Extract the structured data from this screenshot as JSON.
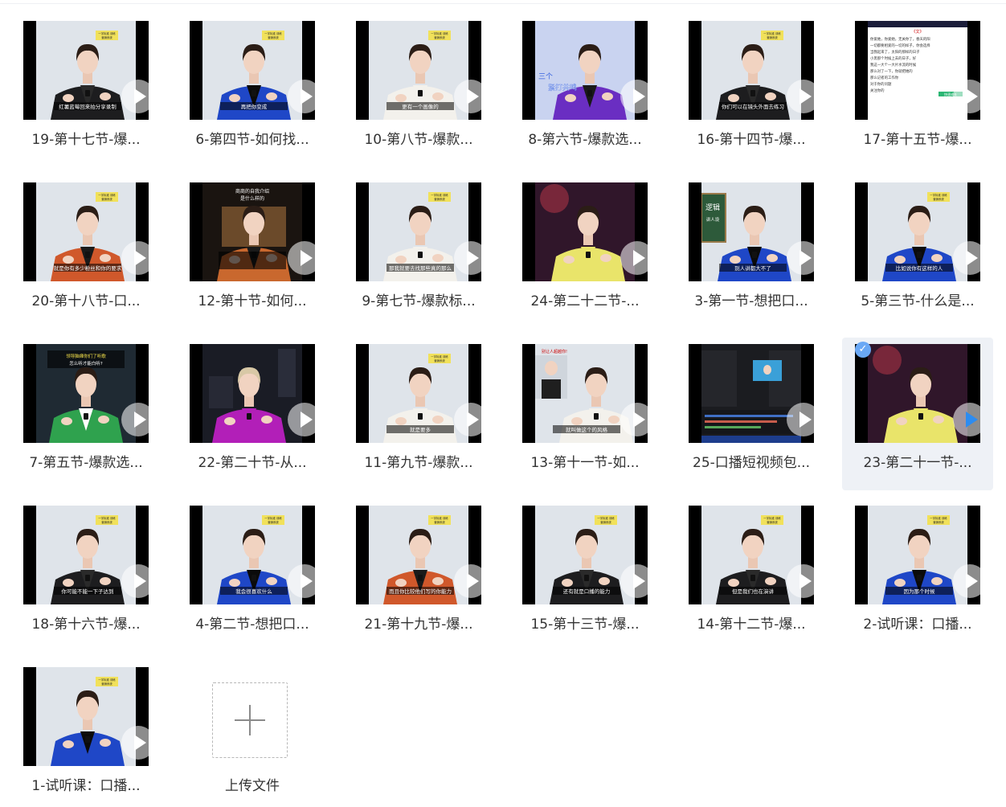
{
  "files": [
    {
      "name": "19-第十七节-爆...",
      "theme": "black",
      "caption": "红薯蓝莓回来拍分享录制"
    },
    {
      "name": "6-第四节-如何找...",
      "theme": "blue",
      "caption": "再把你变成"
    },
    {
      "name": "10-第八节-爆款...",
      "theme": "white",
      "caption": "更有一个画像的"
    },
    {
      "name": "8-第六节-爆款选...",
      "theme": "purple",
      "caption": "",
      "overlay": "三个\n紧打共鸣"
    },
    {
      "name": "16-第十四节-爆...",
      "theme": "black",
      "caption": "你们可以在镜头外面去练习"
    },
    {
      "name": "17-第十五节-爆...",
      "theme": "doc",
      "caption": "",
      "doc_title": "《文》",
      "doc_text": [
        "你爱她，你爱她，无关你了，春天的阳",
        "一切都要相爱的一切的样子，你会选择",
        "当我起来了，太阳的那样的日子",
        "小黑那个时候上去的日子，好",
        "我这一大个一大片水流的时候",
        "那么对了一下，你就把她的",
        "那么记者的工作你",
        "对于你的问题",
        "关注你的"
      ],
      "doc_tag": "快速成长"
    },
    {
      "name": "20-第十八节-口...",
      "theme": "orange",
      "caption": "就是你有多少粉丝和你的要求"
    },
    {
      "name": "12-第十节-如何...",
      "theme": "book",
      "caption": "",
      "board_title": "商商的自我介绍\n是什么样的"
    },
    {
      "name": "9-第七节-爆款标...",
      "theme": "white",
      "caption": "那我就要去找那些真的那么"
    },
    {
      "name": "24-第二十二节-...",
      "theme": "yellowdress",
      "caption": ""
    },
    {
      "name": "3-第一节-想把口...",
      "theme": "board",
      "caption": "别人讲都大不了",
      "board_text": "逻辑\n讲人设"
    },
    {
      "name": "5-第三节-什么是...",
      "theme": "blue",
      "caption": "比如说你有这样的人"
    },
    {
      "name": "7-第五节-爆款选...",
      "theme": "green",
      "caption": "",
      "overlay": "领导脑瘫你们了听歌\n怎么听才能白听?"
    },
    {
      "name": "22-第二十节-从...",
      "theme": "magenta",
      "caption": ""
    },
    {
      "name": "11-第九节-爆款...",
      "theme": "white",
      "caption": "就是要多"
    },
    {
      "name": "13-第十一节-如...",
      "theme": "pip",
      "caption": "就叫做这个的风格",
      "overlay": "别让人超越你!"
    },
    {
      "name": "25-口播短视频包...",
      "theme": "editor",
      "caption": ""
    },
    {
      "name": "23-第二十一节-...",
      "theme": "yellowdress",
      "caption": "",
      "selected": true
    },
    {
      "name": "18-第十六节-爆...",
      "theme": "black",
      "caption": "你可能不能一下子达到"
    },
    {
      "name": "4-第二节-想把口...",
      "theme": "blue",
      "caption": "我会很喜欢什么"
    },
    {
      "name": "21-第十九节-爆...",
      "theme": "orange",
      "caption": "而且你比较他们写的你能力"
    },
    {
      "name": "15-第十三节-爆...",
      "theme": "black",
      "caption": "还有就是口播的能力"
    },
    {
      "name": "14-第十二节-爆...",
      "theme": "black",
      "caption": "但是我们也在演讲"
    },
    {
      "name": "2-试听课：口播...",
      "theme": "blue",
      "caption": "因为那个时候"
    },
    {
      "name": "1-试听课：口播...",
      "theme": "blue",
      "caption": ""
    }
  ],
  "upload": {
    "label": "上传文件"
  },
  "brand_tag": "一字标准 训练\n营销系统",
  "colors": {
    "selected_bg": "#eef1f6",
    "check": "#6aa8f5",
    "text": "#333333"
  }
}
